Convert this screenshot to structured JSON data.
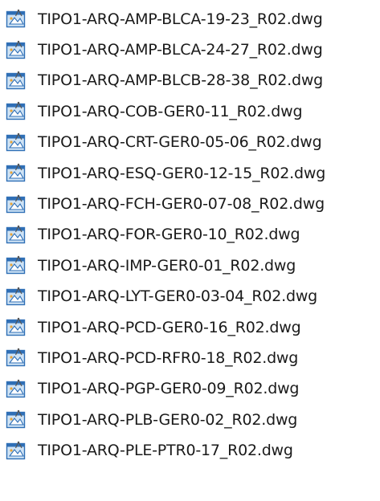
{
  "file_icon": "autocad-dwg-file-icon",
  "colors": {
    "icon_blue": "#2f6fb6",
    "icon_light": "#cfe3f5",
    "icon_accent": "#e8a53a",
    "text": "#1a1a1a"
  },
  "files": [
    {
      "name": "TIPO1-ARQ-AMP-BLCA-19-23_R02.dwg"
    },
    {
      "name": "TIPO1-ARQ-AMP-BLCA-24-27_R02.dwg"
    },
    {
      "name": "TIPO1-ARQ-AMP-BLCB-28-38_R02.dwg"
    },
    {
      "name": "TIPO1-ARQ-COB-GER0-11_R02.dwg"
    },
    {
      "name": "TIPO1-ARQ-CRT-GER0-05-06_R02.dwg"
    },
    {
      "name": "TIPO1-ARQ-ESQ-GER0-12-15_R02.dwg"
    },
    {
      "name": "TIPO1-ARQ-FCH-GER0-07-08_R02.dwg"
    },
    {
      "name": "TIPO1-ARQ-FOR-GER0-10_R02.dwg"
    },
    {
      "name": "TIPO1-ARQ-IMP-GER0-01_R02.dwg"
    },
    {
      "name": "TIPO1-ARQ-LYT-GER0-03-04_R02.dwg"
    },
    {
      "name": "TIPO1-ARQ-PCD-GER0-16_R02.dwg"
    },
    {
      "name": "TIPO1-ARQ-PCD-RFR0-18_R02.dwg"
    },
    {
      "name": "TIPO1-ARQ-PGP-GER0-09_R02.dwg"
    },
    {
      "name": "TIPO1-ARQ-PLB-GER0-02_R02.dwg"
    },
    {
      "name": "TIPO1-ARQ-PLE-PTR0-17_R02.dwg"
    }
  ]
}
